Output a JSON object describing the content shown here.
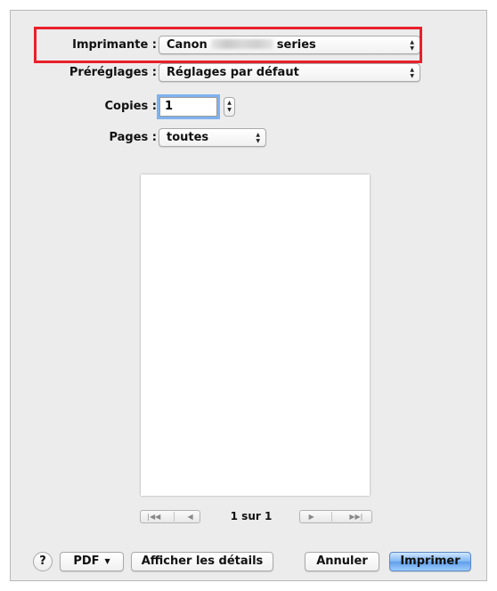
{
  "printer": {
    "label": "Imprimante :",
    "brand": "Canon",
    "model_blurred": "",
    "suffix": "series"
  },
  "presets": {
    "label": "Préréglages :",
    "value": "Réglages par défaut"
  },
  "copies": {
    "label": "Copies :",
    "value": "1"
  },
  "pages": {
    "label": "Pages :",
    "value": "toutes"
  },
  "preview": {
    "page_info": "1 sur 1"
  },
  "footer": {
    "help": "?",
    "pdf": "PDF",
    "details": "Afficher les détails",
    "cancel": "Annuler",
    "print": "Imprimer"
  },
  "icons": {
    "updown": "up-down-arrows-icon",
    "first": "first-page-icon",
    "prev": "previous-page-icon",
    "next": "next-page-icon",
    "last": "last-page-icon"
  },
  "colors": {
    "highlight": "#e8202a",
    "primary_button": "#6aa6ee",
    "focus_ring": "#7fb2f0"
  }
}
